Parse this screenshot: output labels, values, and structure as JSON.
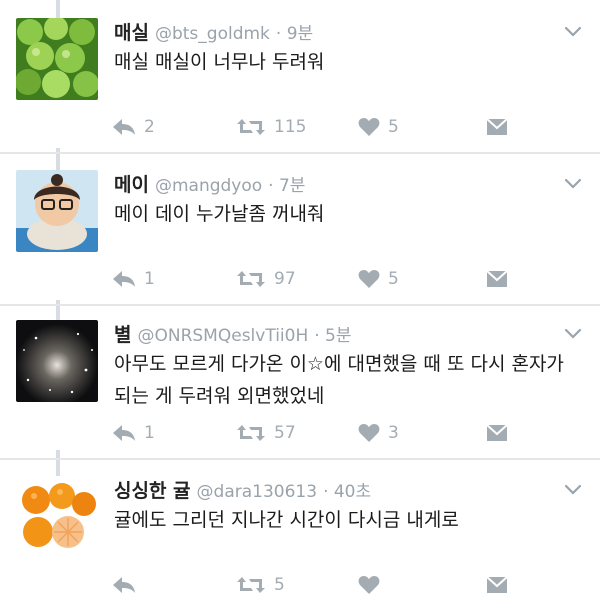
{
  "tweets": [
    {
      "name": "매실",
      "handle": "@bts_goldmk",
      "time": "· 9분",
      "text": [
        "매실 매실이 너무나 두려워"
      ],
      "replies": "2",
      "retweets": "115",
      "likes": "5",
      "avatar": "green-fruit-avatar"
    },
    {
      "name": "메이",
      "handle": "@mangdyoo",
      "time": "· 7분",
      "text": [
        "메이 데이 누가날좀 꺼내줘"
      ],
      "replies": "1",
      "retweets": "97",
      "likes": "5",
      "avatar": "character-avatar"
    },
    {
      "name": "별",
      "handle": "@ONRSMQeslvTii0H",
      "time": "· 5분",
      "text": [
        "아무도 모르게 다가온 이☆에 대면했을 때 또 다시 혼자가",
        "되는 게 두려워 외면했었네"
      ],
      "replies": "1",
      "retweets": "57",
      "likes": "3",
      "avatar": "star-cluster-avatar"
    },
    {
      "name": "싱싱한 귤",
      "handle": "@dara130613",
      "time": "· 40초",
      "text": [
        "귤에도 그리던 지나간 시간이 다시금 내게로"
      ],
      "replies": "",
      "retweets": "5",
      "likes": "",
      "avatar": "tangerine-avatar"
    }
  ],
  "colors": {
    "icon": "#a4acb3",
    "name": "#222222",
    "muted": "#9aa3ab",
    "thread": "#d7dde2"
  }
}
